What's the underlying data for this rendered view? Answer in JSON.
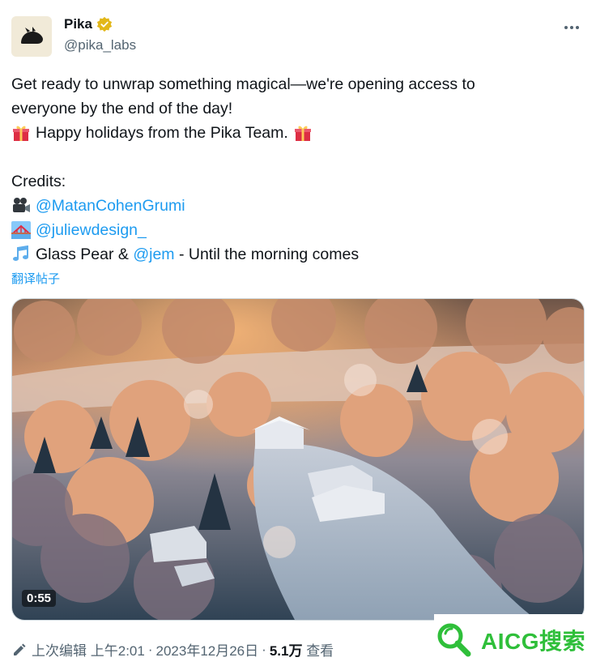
{
  "author": {
    "display_name": "Pika",
    "handle": "@pika_labs"
  },
  "tweet": {
    "line1": "Get ready to unwrap something magical—we're opening access to",
    "line2": "everyone by the end of the day!",
    "line3": "Happy holidays from the Pika Team.",
    "credits_label": "Credits:",
    "credit1_mention": "@MatanCohenGrumi",
    "credit2_mention": "@juliewdesign_",
    "credit3_prefix": "Glass Pear &",
    "credit3_mention": "@jem",
    "credit3_suffix": "- Until the morning comes",
    "translate": "翻译帖子"
  },
  "media": {
    "duration": "0:55"
  },
  "meta": {
    "edited_label": "上次编辑",
    "time": "上午2:01",
    "date": "2023年12月26日",
    "views_count": "5.1万",
    "views_label": "查看"
  },
  "watermark": {
    "text": "AICG搜索"
  },
  "icons": {
    "verified": "verified-badge-icon",
    "more": "more-icon",
    "gift": "gift-emoji",
    "camera": "movie-camera-emoji",
    "bridge": "bridge-emoji",
    "music": "music-notes-emoji",
    "edit": "pencil-icon"
  },
  "colors": {
    "link": "#1d9bf0",
    "verified": "#e2b719",
    "secondary": "#536471",
    "watermark": "#2fbf3a"
  }
}
